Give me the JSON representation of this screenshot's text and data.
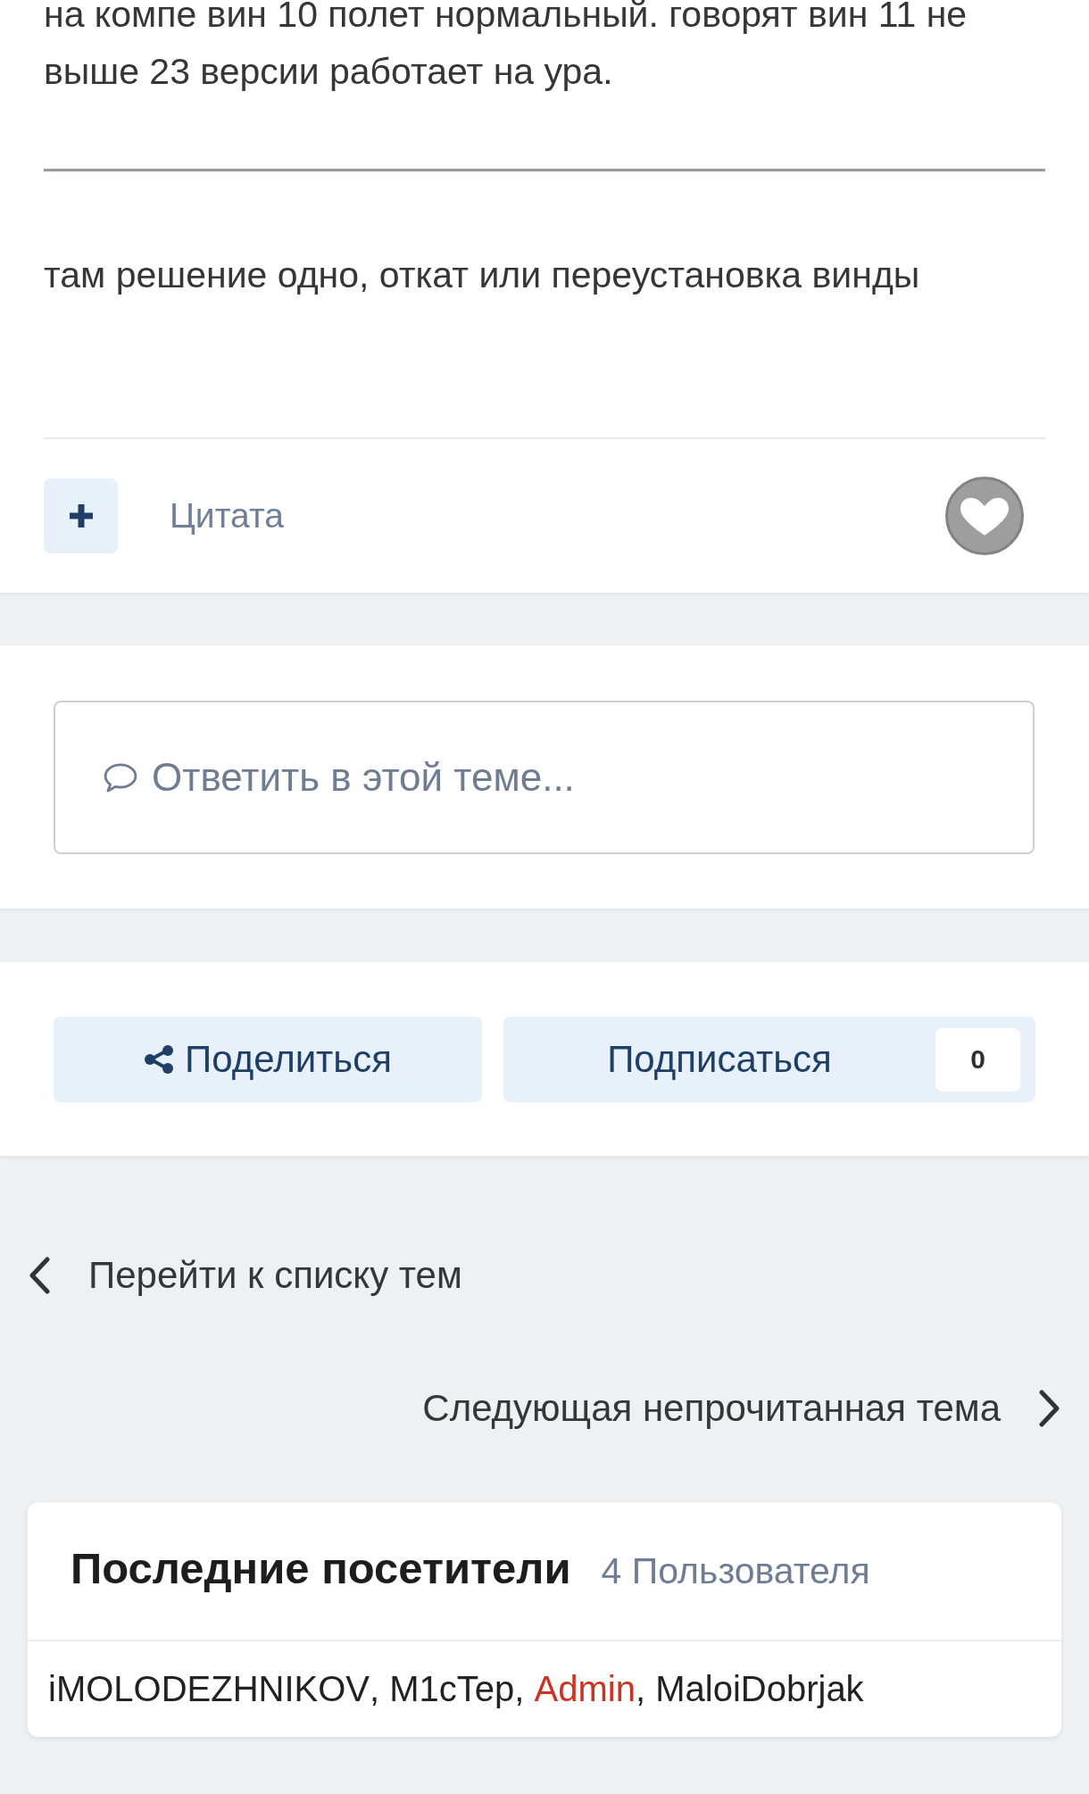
{
  "post": {
    "body": [
      {
        "kind": "paragraph",
        "text": "на компе вин 10 полет нормальный. говорят вин 11 не выше 23 версии работает на ура."
      },
      {
        "kind": "separator"
      },
      {
        "kind": "paragraph",
        "text": "там решение одно, откат или переустановка винды"
      }
    ],
    "quote_label": "Цитата"
  },
  "reply_box": {
    "placeholder": "Ответить в этой теме..."
  },
  "share_bar": {
    "share_label": "Поделиться",
    "follow_label": "Подписаться",
    "follower_count": "0"
  },
  "topic_navigation": {
    "previous": "Перейти к списку тем",
    "next": "Следующая непрочитанная тема"
  },
  "recent_visitors": {
    "title": "Последние посетители",
    "count": "4 Пользователя",
    "separator": ", ",
    "users": [
      {
        "name": "iMOLODEZHNIKOV",
        "color": "#222222"
      },
      {
        "name": "M1cTep",
        "color": "#222222"
      },
      {
        "name": "Admin",
        "color": "#cc3322"
      },
      {
        "name": "MaloiDobrjak",
        "color": "#222222"
      }
    ]
  }
}
